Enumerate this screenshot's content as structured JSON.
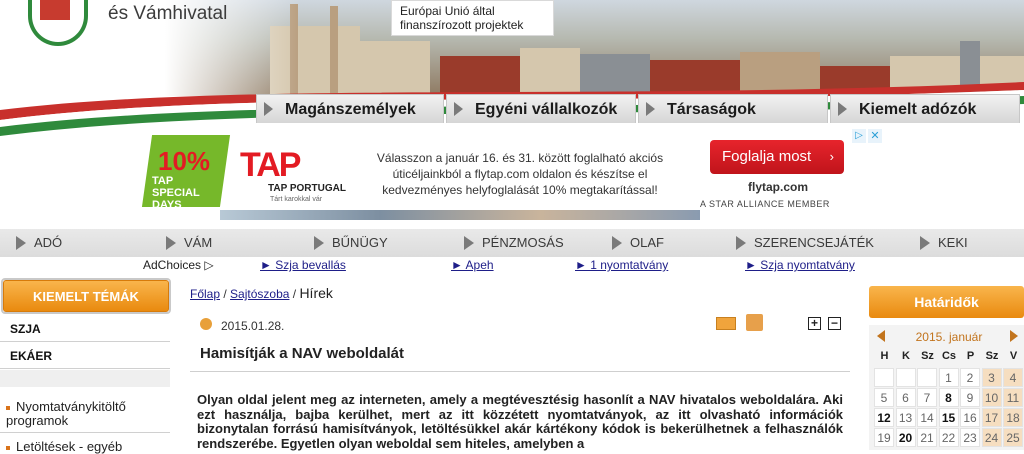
{
  "header": {
    "agency_name": "és Vámhivatal",
    "eu_notice": "Európai Unió által finanszírozott projektek"
  },
  "top_tabs": [
    {
      "label": "Magánszemélyek"
    },
    {
      "label": "Egyéni vállalkozók"
    },
    {
      "label": "Társaságok"
    },
    {
      "label": "Kiemelt adózók"
    }
  ],
  "ad": {
    "badge_percent": "10%",
    "badge_text": "TAP SPECIAL DAYS",
    "brand_logo": "TAP",
    "brand_name": "TAP PORTUGAL",
    "brand_tagline": "Tárt karokkal vár",
    "message": "Válasszon a január 16. és 31. között foglalható akciós úticéljainkból a flytap.com oldalon és készítse el kedvezményes helyfoglalását 10% megtakarítással!",
    "cta": "Foglalja most",
    "url": "flytap.com",
    "alliance": "A STAR ALLIANCE MEMBER"
  },
  "nav2": [
    {
      "label": "ADÓ"
    },
    {
      "label": "VÁM"
    },
    {
      "label": "BŰNÜGY"
    },
    {
      "label": "PÉNZMOSÁS"
    },
    {
      "label": "OLAF"
    },
    {
      "label": "SZERENCSEJÁTÉK"
    },
    {
      "label": "KEKI"
    }
  ],
  "adchoices": "AdChoices",
  "links3": [
    {
      "label": "► Szja bevallás"
    },
    {
      "label": "► Apeh"
    },
    {
      "label": "► 1 nyomtatvány"
    },
    {
      "label": "► Szja nyomtatvány"
    }
  ],
  "left_sidebar": {
    "header": "KIEMELT TÉMÁK",
    "items": [
      {
        "label": "SZJA"
      },
      {
        "label": "EKÁER"
      }
    ],
    "links": [
      {
        "label": "Nyomtatványkitöltő programok"
      },
      {
        "label": "Letöltések - egyéb"
      }
    ]
  },
  "main": {
    "breadcrumb": {
      "home": "Főlap",
      "section": "Sajtószoba",
      "current": "Hírek"
    },
    "date": "2015.01.28.",
    "title": "Hamisítják a NAV weboldalát",
    "body": "Olyan oldal jelent meg az interneten, amely a megtévesztésig hasonlít a NAV hivatalos weboldalára. Aki ezt használja, bajba kerülhet, mert az itt közzétett nyomtatványok, az itt olvasható információk bizonytalan forrású hamisítványok, letöltésükkel akár kártékony kódok is bekerülhetnek a felhasználók rendszerébe. Egyetlen olyan weboldal sem hiteles, amelyben a"
  },
  "right_sidebar": {
    "header": "Határidők",
    "calendar": {
      "title": "2015. január",
      "dow": [
        "H",
        "K",
        "Sz",
        "Cs",
        "P",
        "Sz",
        "V"
      ],
      "rows": [
        [
          "",
          "",
          "",
          "1",
          "2",
          "3",
          "4"
        ],
        [
          "5",
          "6",
          "7",
          "8",
          "9",
          "10",
          "11"
        ],
        [
          "12",
          "13",
          "14",
          "15",
          "16",
          "17",
          "18"
        ],
        [
          "19",
          "20",
          "21",
          "22",
          "23",
          "24",
          "25"
        ]
      ],
      "bold_days": [
        "8",
        "12",
        "15",
        "20"
      ]
    }
  }
}
